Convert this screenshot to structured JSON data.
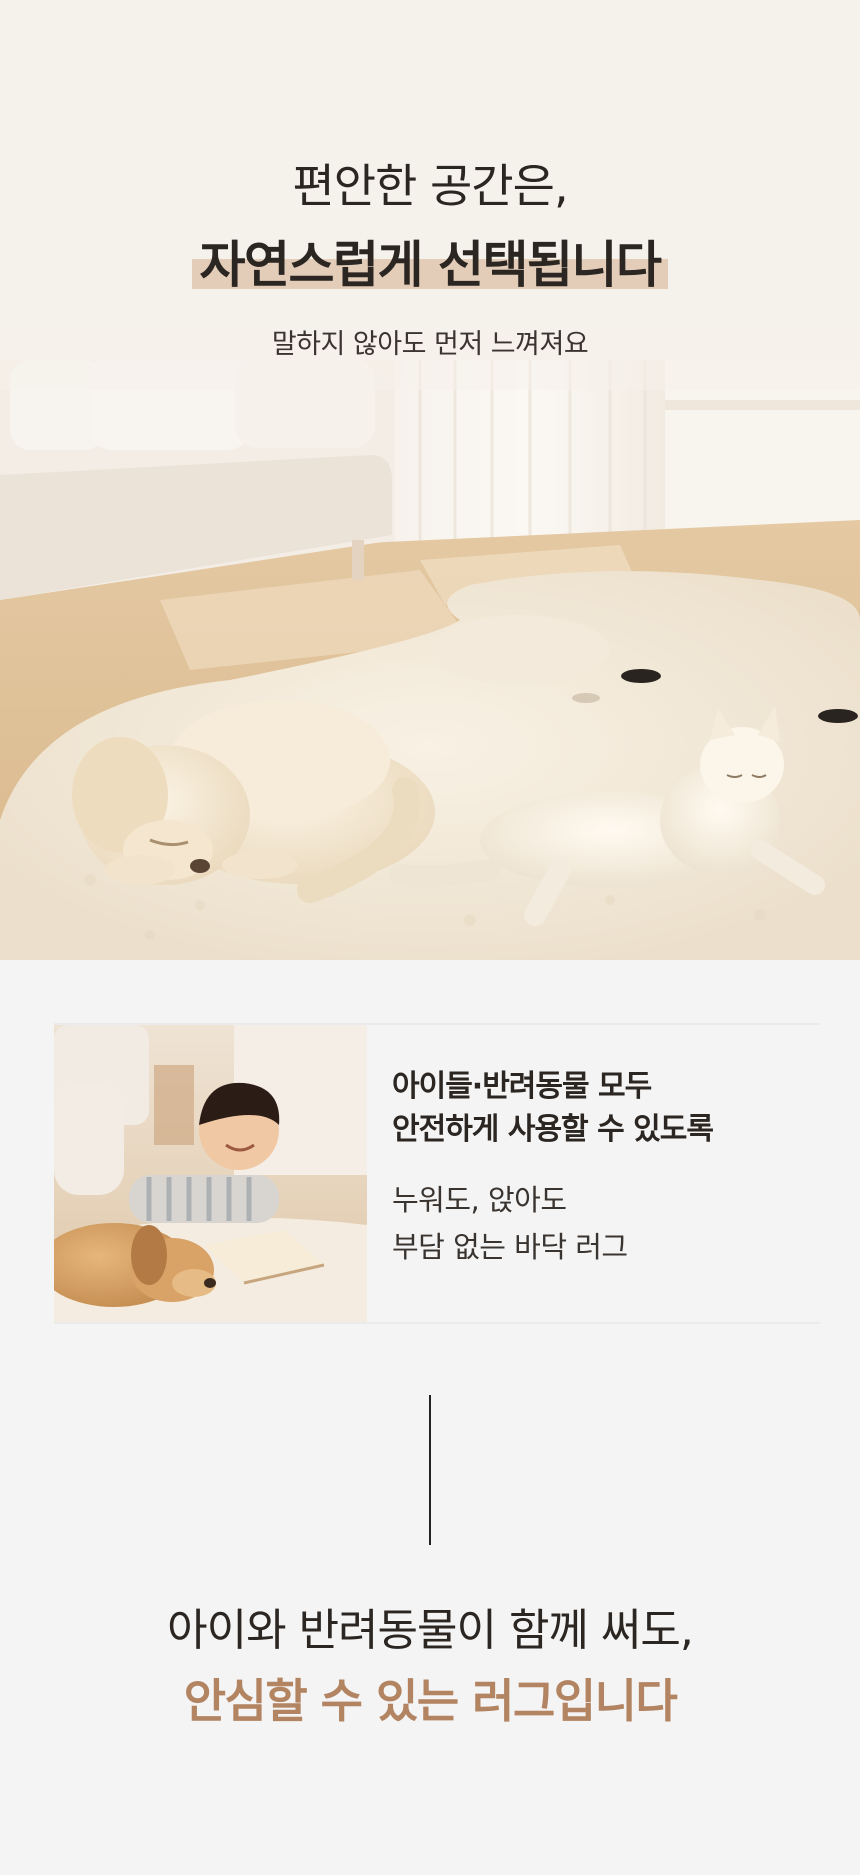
{
  "hero": {
    "title_line1": "편안한 공간은,",
    "title_line2": "자연스럽게 선택됩니다",
    "subtitle": "말하지 않아도 먼저 느껴져요"
  },
  "feature": {
    "title_line1": "아이들·반려동물 모두",
    "title_line2": "안전하게 사용할 수 있도록",
    "desc_line1": "누워도, 앉아도",
    "desc_line2": "부담 없는 바닥 러그"
  },
  "closing": {
    "line1": "아이와 반려동물이 함께 써도,",
    "line2": "안심할 수 있는 러그입니다"
  },
  "colors": {
    "accent": "#b28462",
    "highlight": "#e3cdb9",
    "background": "#f4f4f4",
    "hero_background": "#f5f1eb"
  }
}
